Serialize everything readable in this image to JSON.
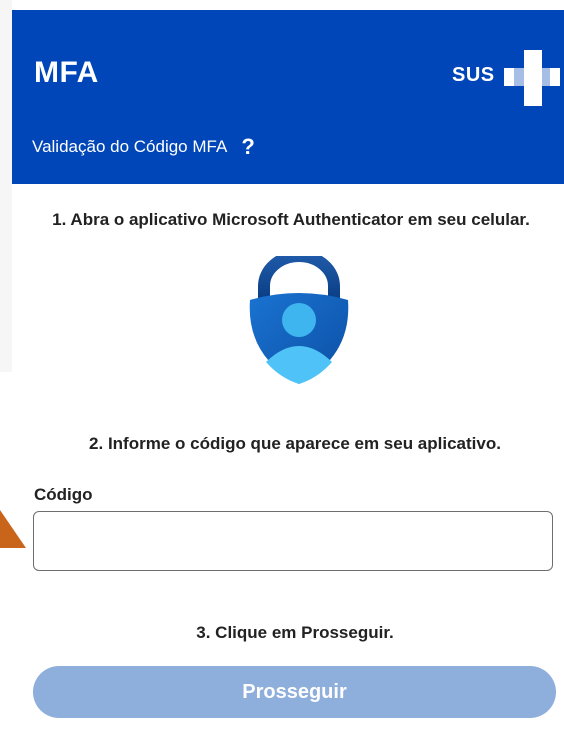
{
  "header": {
    "title": "MFA",
    "subtitle": "Validação do Código MFA",
    "help_icon": "question-mark-icon",
    "logo_text": "SUS",
    "background_color": "#0046b8"
  },
  "steps": {
    "step1": "1. Abra o aplicativo Microsoft Authenticator em seu celular.",
    "step2": "2. Informe o código que aparece em seu aplicativo.",
    "step3": "3. Clique em Prosseguir."
  },
  "authenticator_icon": "microsoft-authenticator-icon",
  "form": {
    "code_label": "Código",
    "code_value": "",
    "code_placeholder": ""
  },
  "submit_button": {
    "label": "Prosseguir",
    "color": "#8eaedb"
  },
  "pointer": {
    "color": "#c8651b"
  }
}
